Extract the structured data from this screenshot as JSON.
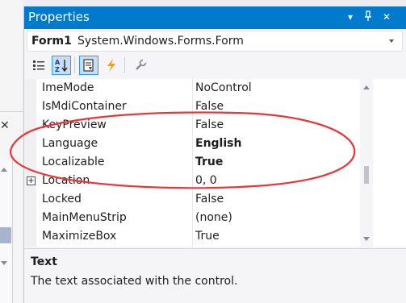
{
  "window": {
    "title": "Properties",
    "icons": [
      "dropdown-arrow",
      "pin",
      "close"
    ]
  },
  "object_selector": {
    "name": "Form1",
    "type": "System.Windows.Forms.Form"
  },
  "toolbar": {
    "buttons": [
      "categorized-icon",
      "alphabetical-icon",
      "properties-icon",
      "events-icon",
      "property-pages-icon"
    ],
    "active": [
      "alphabetical-icon",
      "properties-icon"
    ]
  },
  "grid": {
    "rows": [
      {
        "name": "ImeMode",
        "value": "NoControl",
        "bold": false,
        "expandable": false
      },
      {
        "name": "IsMdiContainer",
        "value": "False",
        "bold": false,
        "expandable": false
      },
      {
        "name": "KeyPreview",
        "value": "False",
        "bold": false,
        "expandable": false
      },
      {
        "name": "Language",
        "value": "English",
        "bold": true,
        "expandable": false
      },
      {
        "name": "Localizable",
        "value": "True",
        "bold": true,
        "expandable": false
      },
      {
        "name": "Location",
        "value": "0, 0",
        "bold": false,
        "expandable": true
      },
      {
        "name": "Locked",
        "value": "False",
        "bold": false,
        "expandable": false
      },
      {
        "name": "MainMenuStrip",
        "value": "(none)",
        "bold": false,
        "expandable": false
      },
      {
        "name": "MaximizeBox",
        "value": "True",
        "bold": false,
        "expandable": false
      }
    ]
  },
  "description": {
    "title": "Text",
    "text": "The text associated with the control."
  },
  "colors": {
    "titlebar": "#007acc",
    "annotation": "#e8373a",
    "lightning": "#ff9c00"
  }
}
